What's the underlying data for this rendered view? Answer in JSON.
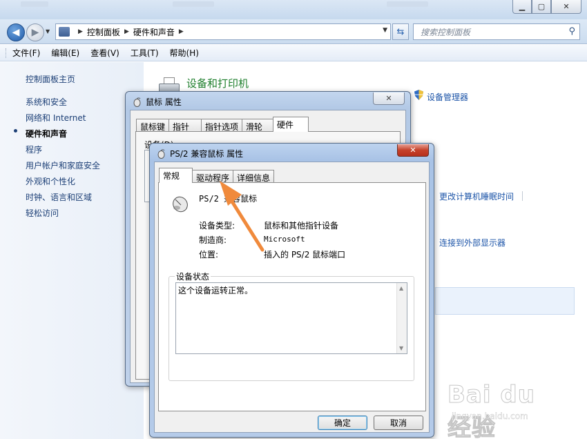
{
  "explorer": {
    "address": {
      "crumbs": [
        "控制面板",
        "硬件和声音"
      ]
    },
    "search_placeholder": "搜索控制面板",
    "menu": [
      "文件(F)",
      "编辑(E)",
      "查看(V)",
      "工具(T)",
      "帮助(H)"
    ],
    "sidebar": {
      "home": "控制面板主页",
      "items": [
        "系统和安全",
        "网络和 Internet",
        "硬件和声音",
        "程序",
        "用户帐户和家庭安全",
        "外观和个性化",
        "时钟、语言和区域",
        "轻松访问"
      ],
      "active_index": 2
    },
    "main": {
      "title": "设备和打印机",
      "device_manager": "设备管理器",
      "sleep_link": "更改计算机睡眠时间",
      "display_link": "连接到外部显示器"
    }
  },
  "mouse_dialog": {
    "title": "鼠标 属性",
    "tabs": [
      "鼠标键",
      "指针",
      "指针选项",
      "滑轮",
      "硬件"
    ],
    "selected_tab": 4,
    "devices_label": "设备(D):"
  },
  "ps2_dialog": {
    "title": "PS/2 兼容鼠标 属性",
    "tabs": [
      "常规",
      "驱动程序",
      "详细信息"
    ],
    "selected_tab": 0,
    "device_name": "PS/2 兼容鼠标",
    "device_type_label": "设备类型:",
    "device_type_value": "鼠标和其他指针设备",
    "manufacturer_label": "制造商:",
    "manufacturer_value": "Microsoft",
    "location_label": "位置:",
    "location_value": "插入的 PS/2 鼠标端口",
    "status_group_label": "设备状态",
    "status_text": "这个设备运转正常。",
    "ok_label": "确定",
    "cancel_label": "取消"
  },
  "watermark": {
    "logo": "Bai du 经验",
    "url": "jingyan.baidu.com"
  },
  "colors": {
    "link": "#1c54a8",
    "title_green": "#1e7e2c",
    "arrow": "#f08a3c"
  }
}
